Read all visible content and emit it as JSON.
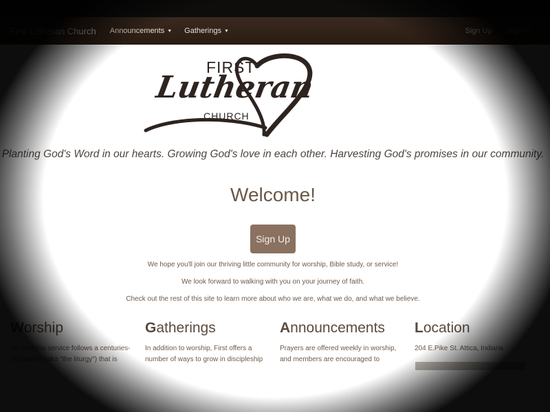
{
  "nav": {
    "brand": "First Lutheran Church",
    "items": [
      {
        "label": "Announcements",
        "caret": "▼"
      },
      {
        "label": "Gatherings",
        "caret": "▼"
      }
    ],
    "sign_up": "Sign Up",
    "sign_in": "Sign In"
  },
  "logo": {
    "first": "FIRST",
    "lutheran": "Lutheran",
    "church": "CHURCH"
  },
  "hero": {
    "tagline": "Planting God's Word in our hearts. Growing God's love in each other. Harvesting God's promises in our community.",
    "welcome": "Welcome!",
    "signup_button": "Sign Up",
    "lines": [
      "We hope you'll join our thriving little community for worship, Bible study, or service!",
      "We look forward to walking with you on your journey of faith.",
      "Check out the rest of this site to learn more about who we are, what we do, and what we believe."
    ]
  },
  "columns": [
    {
      "cap": "W",
      "rest": "orship",
      "text": "our worship service follows a centuries-old pattern (aka \"the liturgy\") that is"
    },
    {
      "cap": "G",
      "rest": "atherings",
      "text": "In addition to worship, First offers a number of ways to grow in discipleship"
    },
    {
      "cap": "A",
      "rest": "nnouncements",
      "text": "Prayers are offered weekly in worship, and members are encouraged to"
    },
    {
      "cap": "L",
      "rest": "ocation",
      "text": "204 E.Pike St. Attica, Indiana"
    }
  ],
  "colors": {
    "navbar": "#2f2118",
    "button": "#8a7160",
    "heading": "#6b5848"
  },
  "icons": {
    "logo_heart": "heart-ribbon-icon",
    "dropdown": "caret-down-icon"
  }
}
